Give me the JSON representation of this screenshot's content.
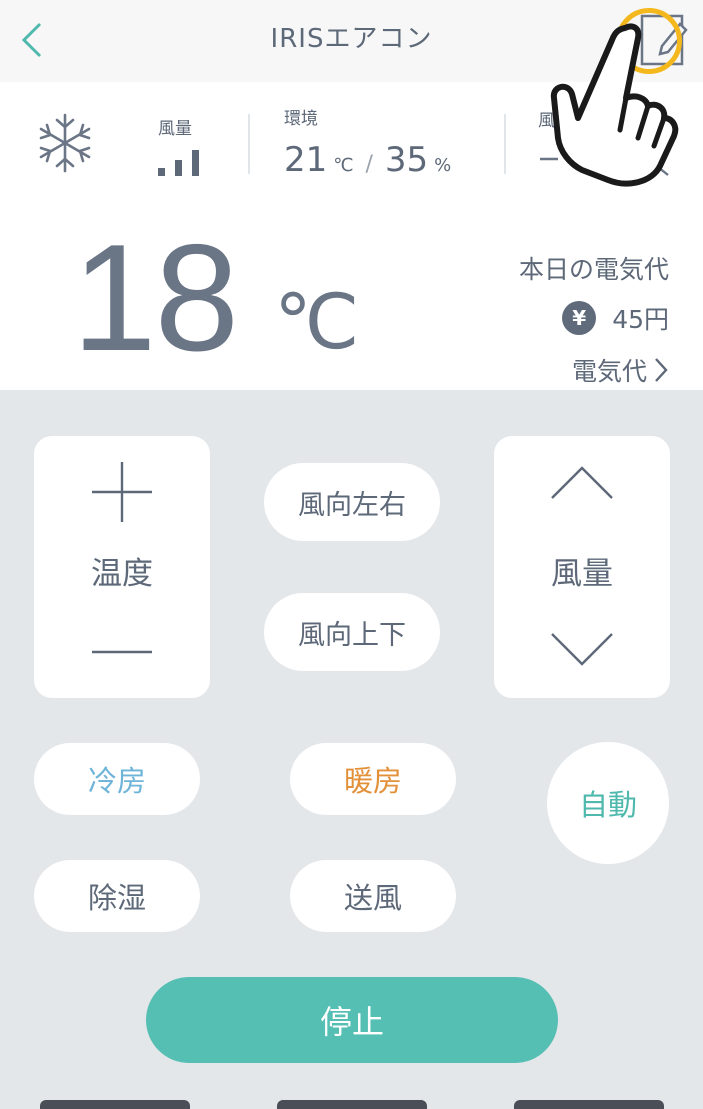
{
  "header": {
    "title": "IRISエアコン",
    "back_icon": "chevron-left-icon",
    "edit_icon": "pencil-edit-icon",
    "accent_color": "#4fb9ad",
    "highlight_color": "#f4b81c"
  },
  "status": {
    "mode_icon": "snowflake-icon",
    "fan_label": "風量",
    "fan_level": 3,
    "env_label": "環境",
    "temperature": "21",
    "temperature_unit": "℃",
    "humidity": "35",
    "humidity_unit": "%",
    "third_label": "風"
  },
  "main": {
    "set_temperature": "18",
    "set_temperature_unit": "℃",
    "cost_title": "本日の電気代",
    "cost_amount": "45円",
    "cost_link": "電気代"
  },
  "controls": {
    "temp_label": "温度",
    "fan_label": "風量",
    "dir_lr": "風向左右",
    "dir_ud": "風向上下",
    "mode_cool": "冷房",
    "mode_heat": "暖房",
    "mode_auto": "自動",
    "mode_dry": "除湿",
    "mode_fan": "送風",
    "stop": "停止"
  },
  "colors": {
    "cool": "#6eb4d8",
    "heat": "#e2913a",
    "auto": "#4fb9ad",
    "stop_bg": "#56bfb4",
    "panel_bg": "#e4e7ea"
  }
}
